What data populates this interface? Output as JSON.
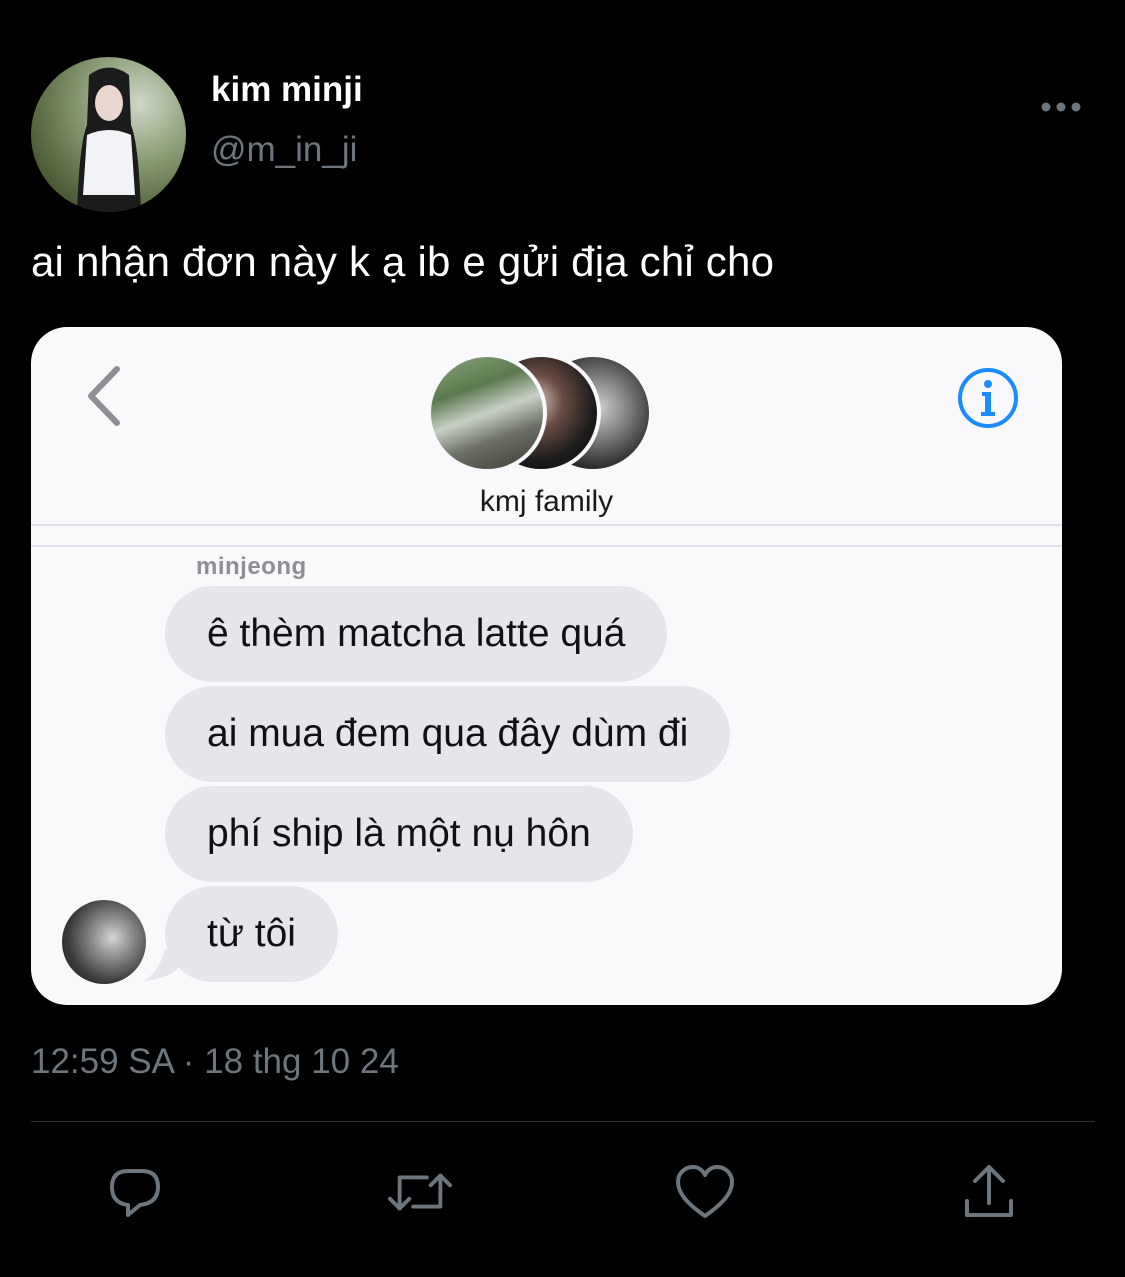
{
  "tweet": {
    "display_name": "kim minji",
    "handle": "@m_in_ji",
    "text": "ai nhận đơn này k ạ ib e gửi địa chỉ cho",
    "timestamp": "12:59 SA · 18 thg 10 24"
  },
  "chat": {
    "group_name": "kmj family",
    "sender": "minjeong",
    "messages": [
      "ê thèm matcha latte quá",
      "ai mua đem qua đây dùm đi",
      "phí ship là một nụ hôn",
      "từ tôi"
    ],
    "accent_color": "#1a8cff"
  },
  "actions": {
    "icons": [
      "reply-icon",
      "retweet-icon",
      "like-icon",
      "share-icon"
    ]
  },
  "colors": {
    "background": "#000000",
    "secondary_text": "#6e767d",
    "bubble": "#e7e5ec"
  }
}
